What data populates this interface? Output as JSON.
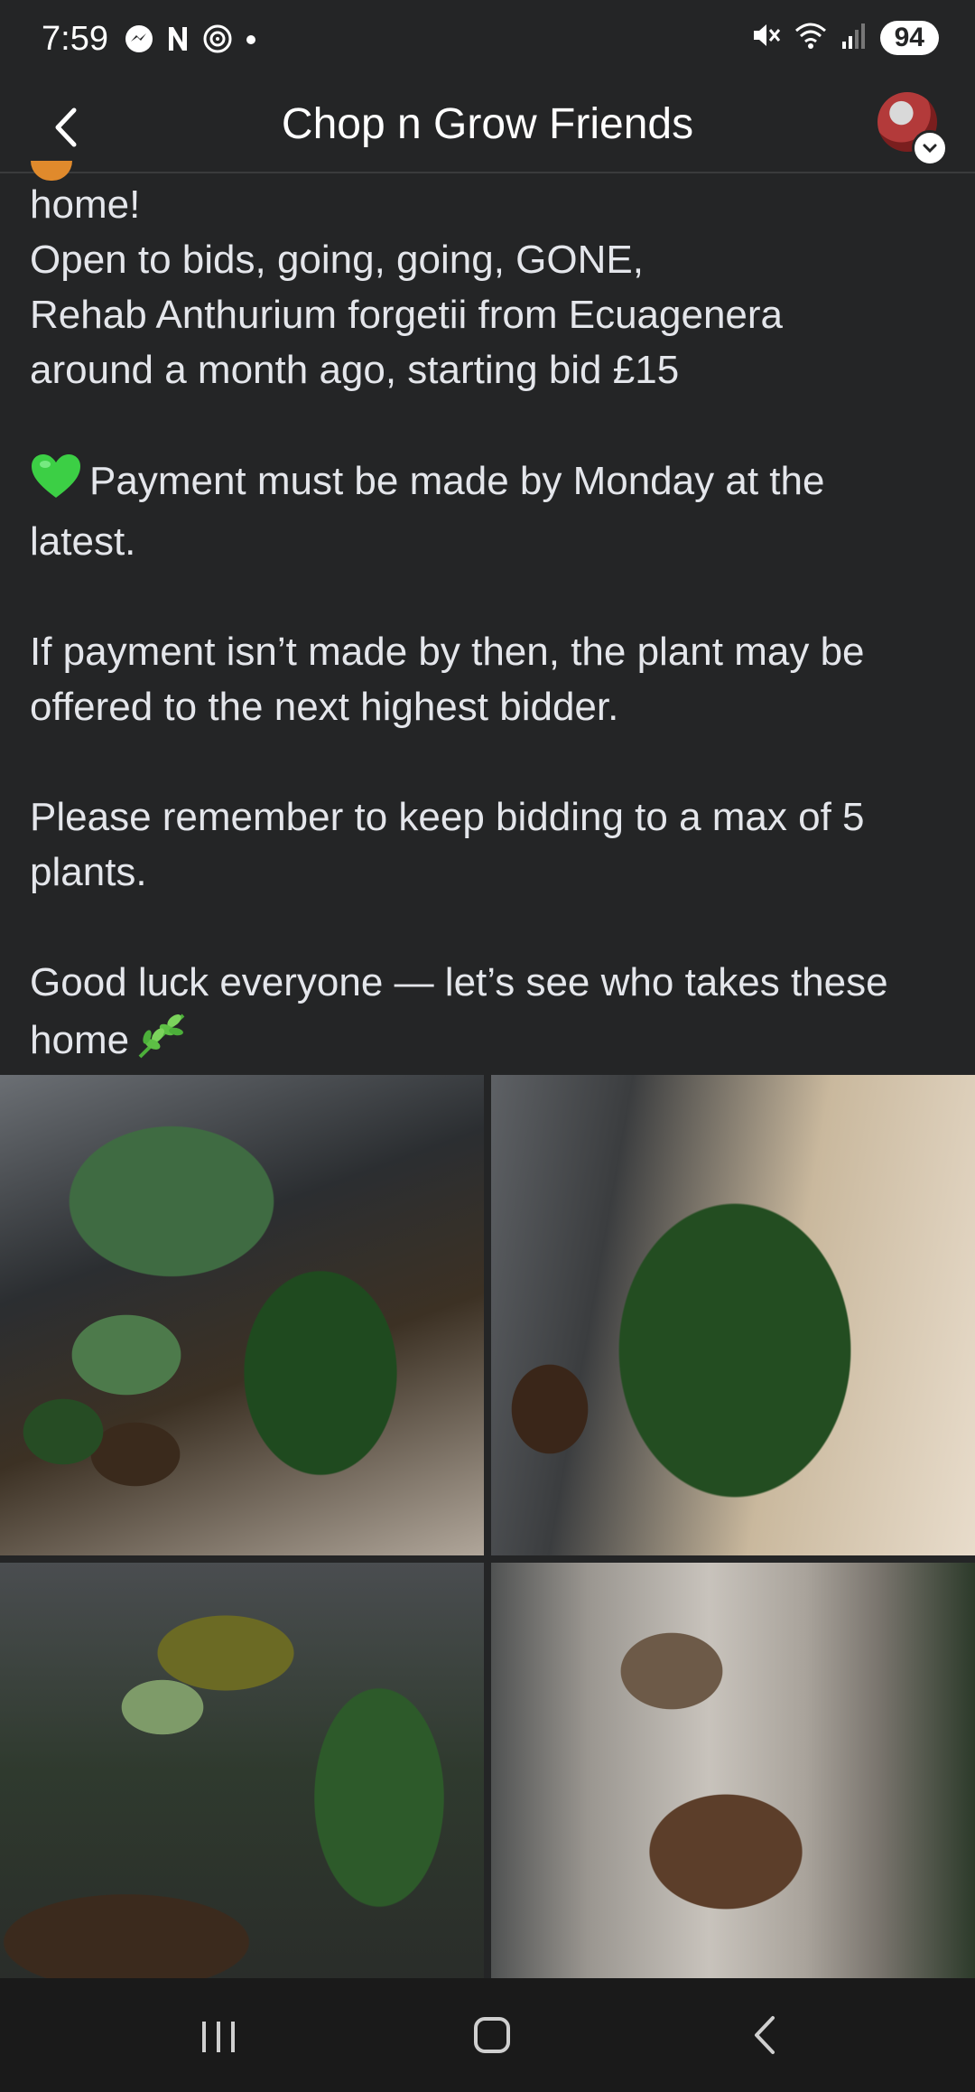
{
  "status_bar": {
    "time": "7:59",
    "battery": "94",
    "icons_left": [
      "messenger-icon",
      "n-icon",
      "nfc-icon",
      "dot-icon"
    ],
    "icons_right": [
      "mute-icon",
      "wifi-icon",
      "signal-icon"
    ]
  },
  "header": {
    "title": "Chop n Grow Friends",
    "back_icon": "chevron-left-icon",
    "avatar_badge_icon": "chevron-down-icon"
  },
  "post": {
    "partial_line_end": "home!",
    "line_1": "Open to bids, going, going, GONE,",
    "line_2": "Rehab Anthurium forgetii from Ecuagenera",
    "line_3": "around a month ago, starting bid £15",
    "payment_line_1": "Payment must be made by Monday at the",
    "payment_line_2": "latest.",
    "offer_line_1": "If payment isn’t made by then, the plant may be",
    "offer_line_2": "offered to the next highest bidder.",
    "max_line_1": "Please remember to keep bidding to a max of 5",
    "max_line_2": "plants.",
    "luck_line_1": "Good luck everyone — let’s see who takes these",
    "luck_line_2": "home",
    "heart_icon": "green-heart-icon",
    "herb_icon": "herb-icon"
  },
  "photos": [
    {
      "name": "anthurium-photo-1"
    },
    {
      "name": "anthurium-photo-2"
    },
    {
      "name": "anthurium-photo-3"
    },
    {
      "name": "pot-roots-photo-4"
    }
  ],
  "nav_bar": {
    "recents_icon": "recents-icon",
    "home_icon": "home-icon",
    "back_icon": "back-icon"
  },
  "colors": {
    "background": "#242526",
    "text": "#e4e6eb",
    "nav_background": "#1a1a1a"
  }
}
